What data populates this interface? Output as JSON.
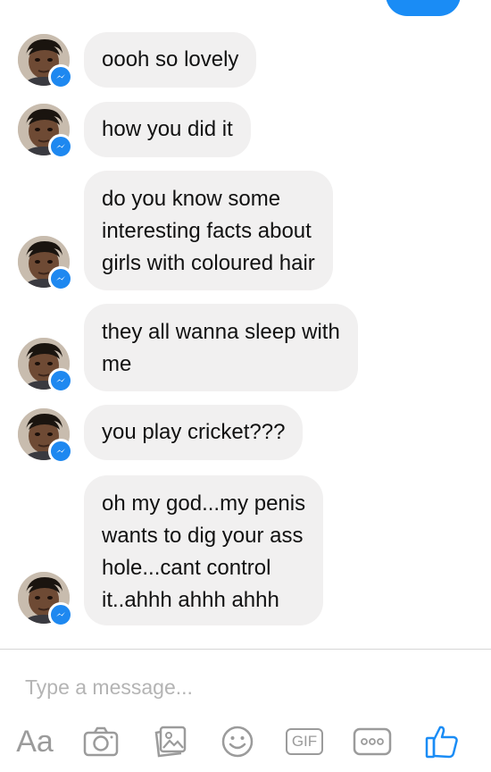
{
  "conversation": {
    "messages": [
      {
        "text": "oooh so lovely"
      },
      {
        "text": "how you did it"
      },
      {
        "text": "do you know some\ninteresting facts about\ngirls with coloured hair"
      },
      {
        "text": "they all wanna sleep with\nme"
      },
      {
        "text": "you play cricket???"
      },
      {
        "text": "oh my god...my penis\nwants to dig your ass\nhole...cant control\nit..ahhh ahhh ahhh"
      }
    ],
    "sent_bubble_color": "#1a8cf5",
    "received_bubble_color": "#f1f0f0",
    "messenger_badge_color": "#1e88f0"
  },
  "composer": {
    "placeholder": "Type a message...",
    "toolbar": {
      "text_style_label": "Aa",
      "gif_label": "GIF",
      "icons": [
        "camera-icon",
        "gallery-icon",
        "emoji-icon",
        "gif-icon",
        "more-icon",
        "like-icon"
      ],
      "accent_color": "#1a8cf5",
      "icon_color": "#9b9b9b"
    }
  }
}
